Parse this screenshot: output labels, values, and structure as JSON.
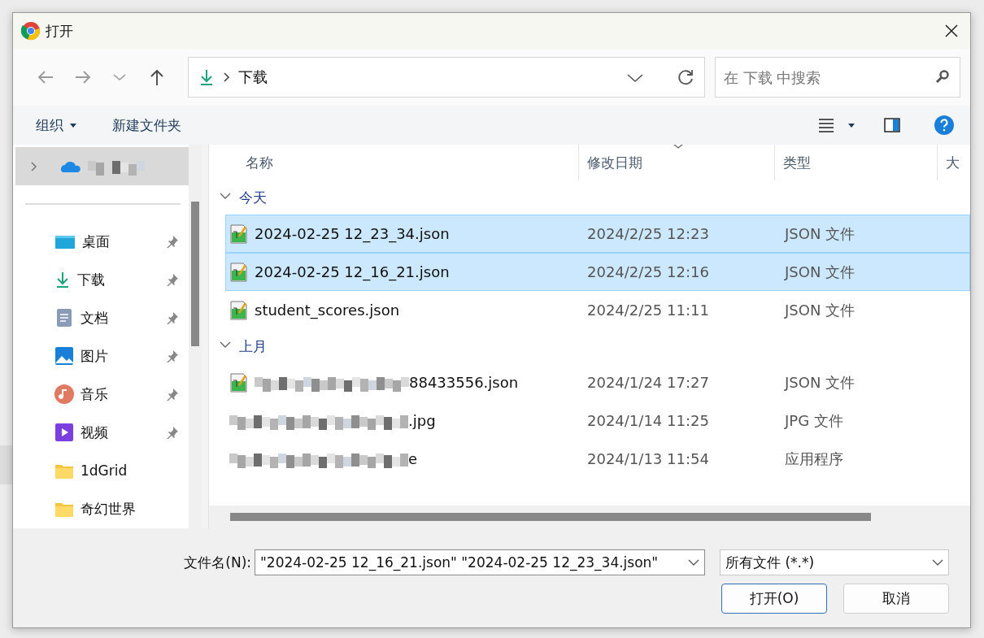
{
  "window": {
    "title": "打开"
  },
  "nav": {
    "path": "下载",
    "search": {
      "placeholder": "在 下载 中搜索"
    }
  },
  "toolbar": {
    "organize": "组织",
    "new_folder": "新建文件夹"
  },
  "sidebar": {
    "items": [
      {
        "kind": "onedrive",
        "blurred": true,
        "selected": true,
        "pinned": false,
        "expander": true
      },
      {
        "kind": "desktop",
        "label": "桌面",
        "blurred": false,
        "selected": false,
        "pinned": true,
        "expander": false
      },
      {
        "kind": "download",
        "label": "下载",
        "blurred": false,
        "selected": false,
        "pinned": true,
        "expander": false
      },
      {
        "kind": "docs",
        "label": "文档",
        "blurred": false,
        "selected": false,
        "pinned": true,
        "expander": false
      },
      {
        "kind": "pictures",
        "label": "图片",
        "blurred": false,
        "selected": false,
        "pinned": true,
        "expander": false
      },
      {
        "kind": "music",
        "label": "音乐",
        "blurred": false,
        "selected": false,
        "pinned": true,
        "expander": false
      },
      {
        "kind": "videos",
        "label": "视频",
        "blurred": false,
        "selected": false,
        "pinned": true,
        "expander": false
      },
      {
        "kind": "folder",
        "label": "1dGrid",
        "blurred": false,
        "selected": false,
        "pinned": false,
        "expander": false
      },
      {
        "kind": "folder",
        "label": "奇幻世界",
        "blurred": false,
        "selected": false,
        "pinned": false,
        "expander": false
      }
    ]
  },
  "table": {
    "columns": [
      "名称",
      "修改日期",
      "类型",
      "大"
    ],
    "groups": [
      {
        "label": "今天",
        "expanded": true,
        "rows": [
          {
            "kind": "json",
            "blurred": false,
            "name": "2024-02-25 12_23_34.json",
            "date": "2024/2/25 12:23",
            "type": "JSON 文件",
            "selected": true
          },
          {
            "kind": "json",
            "blurred": false,
            "name": "2024-02-25 12_16_21.json",
            "date": "2024/2/25 12:16",
            "type": "JSON 文件",
            "selected": true
          },
          {
            "kind": "json",
            "blurred": false,
            "name": "student_scores.json",
            "date": "2024/2/25 11:11",
            "type": "JSON 文件",
            "selected": false
          }
        ]
      },
      {
        "label": "上月",
        "expanded": true,
        "rows": [
          {
            "kind": "json",
            "blurred": true,
            "name": "88433556.json",
            "date": "2024/1/24 17:27",
            "type": "JSON 文件",
            "selected": false
          },
          {
            "kind": "jpg",
            "blurred": true,
            "name": ".jpg",
            "date": "2024/1/14 11:25",
            "type": "JPG 文件",
            "selected": false
          },
          {
            "kind": "exe",
            "blurred": true,
            "name": "e",
            "date": "2024/1/13 11:54",
            "type": "应用程序",
            "selected": false
          }
        ]
      }
    ]
  },
  "footer": {
    "filename_label": "文件名(N):",
    "filename": "\"2024-02-25 12_16_21.json\" \"2024-02-25 12_23_34.json\"",
    "filter": "所有文件 (*.*)",
    "open": "打开(O)",
    "cancel": "取消"
  }
}
